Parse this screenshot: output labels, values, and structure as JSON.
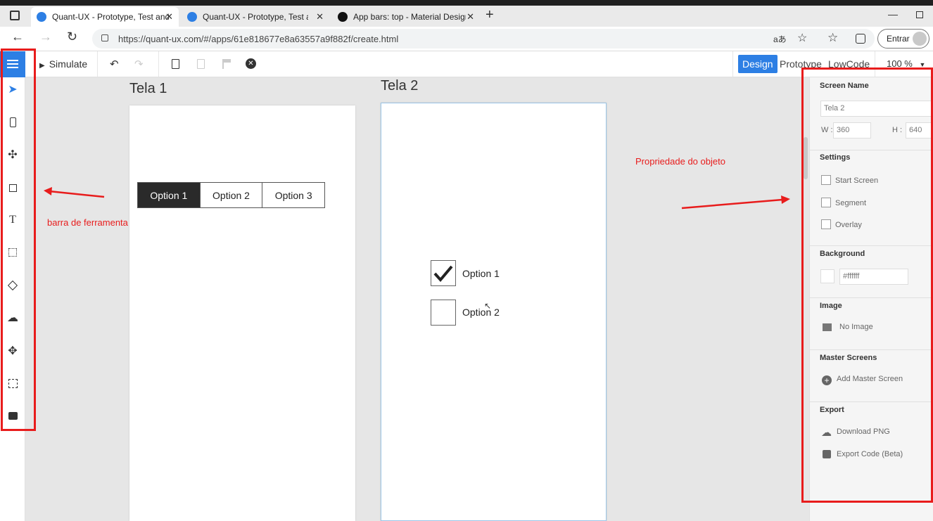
{
  "browser": {
    "tabs": [
      {
        "title": "Quant-UX - Prototype, Test and I",
        "active": true
      },
      {
        "title": "Quant-UX - Prototype, Test and I",
        "active": false
      },
      {
        "title": "App bars: top - Material Design",
        "active": false
      }
    ],
    "url": "https://quant-ux.com/#/apps/61e818677e8a63557a9f882f/create.html",
    "signin_label": "Entrar",
    "translate_icon": "aあ"
  },
  "toolbar": {
    "simulate_label": "Simulate",
    "modes": [
      "Design",
      "Prototype",
      "LowCode"
    ],
    "zoom": "100 %"
  },
  "canvas": {
    "screen1": {
      "title": "Tela 1",
      "segment": [
        "Option 1",
        "Option 2",
        "Option 3"
      ]
    },
    "screen2": {
      "title": "Tela 2",
      "checkboxes": [
        {
          "label": "Option 1",
          "checked": true
        },
        {
          "label": "Option 2",
          "checked": false
        }
      ]
    }
  },
  "annotations": {
    "toolbar_note": "barra de ferramenta",
    "properties_note": "Propriedade do objeto"
  },
  "panel": {
    "screen_name_head": "Screen Name",
    "screen_name_value": "Tela 2",
    "w_label": "W :",
    "w_value": "360",
    "h_label": "H :",
    "h_value": "640",
    "settings_head": "Settings",
    "settings": [
      "Start Screen",
      "Segment",
      "Overlay"
    ],
    "background_head": "Background",
    "background_value": "#ffffff",
    "image_head": "Image",
    "image_value": "No Image",
    "master_head": "Master Screens",
    "master_add": "Add Master Screen",
    "export_head": "Export",
    "export_png": "Download PNG",
    "export_code": "Export Code (Beta)"
  },
  "colors": {
    "accent": "#2d7fe4",
    "annotation_red": "#e81c1c"
  }
}
